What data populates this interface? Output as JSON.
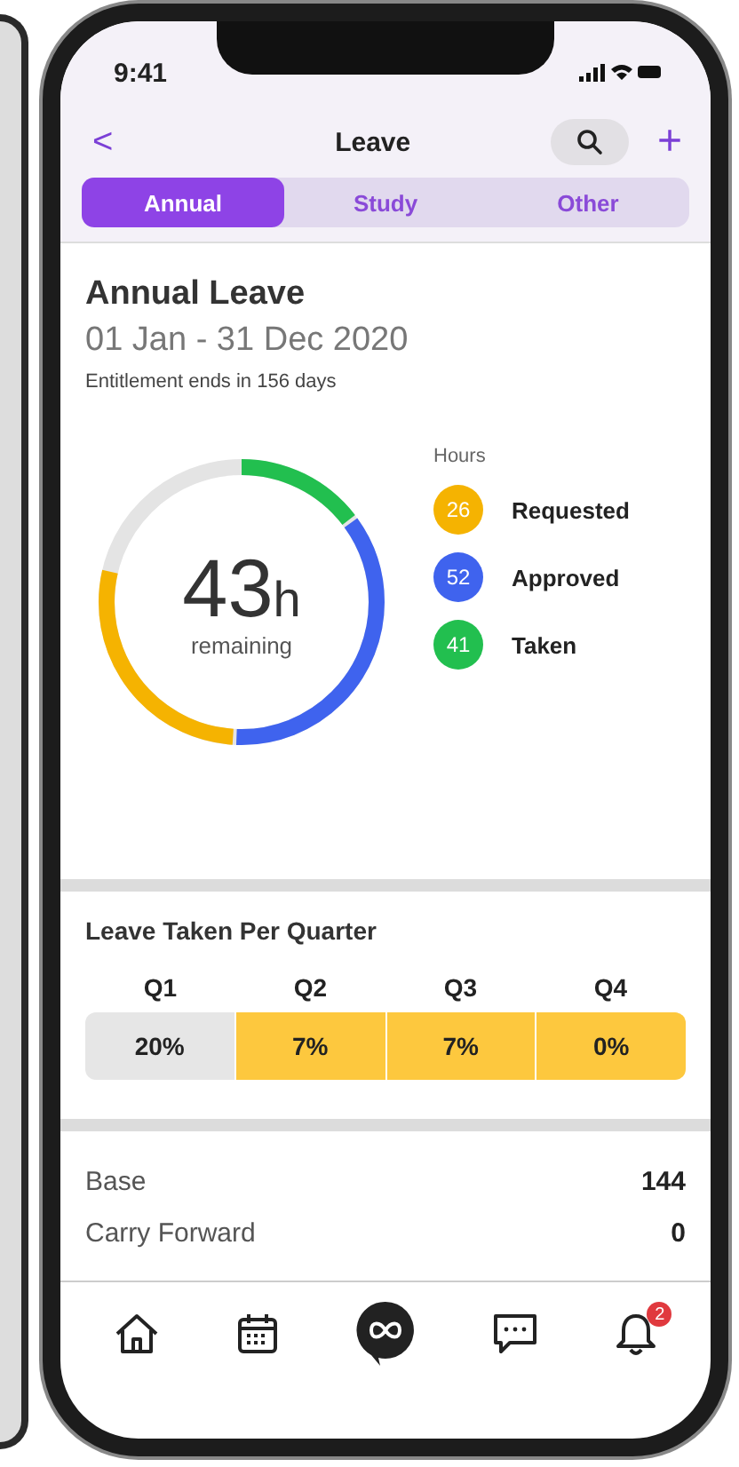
{
  "status_bar": {
    "time": "9:41"
  },
  "header": {
    "back": "<",
    "title": "Leave",
    "add": "+"
  },
  "tabs": [
    {
      "label": "Annual",
      "selected": true
    },
    {
      "label": "Study",
      "selected": false
    },
    {
      "label": "Other",
      "selected": false
    }
  ],
  "summary": {
    "title": "Annual Leave",
    "period": "01 Jan - 31 Dec 2020",
    "note": "Entitlement ends in 156 days",
    "remaining_value": "43",
    "remaining_unit": "h",
    "remaining_label": "remaining",
    "legend_title": "Hours",
    "legend": [
      {
        "value": "26",
        "label": "Requested",
        "color": "#f5b301"
      },
      {
        "value": "52",
        "label": "Approved",
        "color": "#3f63ee"
      },
      {
        "value": "41",
        "label": "Taken",
        "color": "#22bf4f"
      }
    ]
  },
  "quarters": {
    "title": "Leave Taken Per Quarter",
    "items": [
      {
        "label": "Q1",
        "value": "20%",
        "color": "#e6e6e6"
      },
      {
        "label": "Q2",
        "value": "7%",
        "color": "#fdc83e"
      },
      {
        "label": "Q3",
        "value": "7%",
        "color": "#fdc83e"
      },
      {
        "label": "Q4",
        "value": "0%",
        "color": "#fdc83e"
      }
    ]
  },
  "balances": [
    {
      "label": "Base",
      "value": "144"
    },
    {
      "label": "Carry Forward",
      "value": "0"
    }
  ],
  "nav": [
    {
      "kind": "home"
    },
    {
      "kind": "calendar"
    },
    {
      "kind": "center"
    },
    {
      "kind": "chat"
    },
    {
      "kind": "bell",
      "badge": "2"
    }
  ]
}
